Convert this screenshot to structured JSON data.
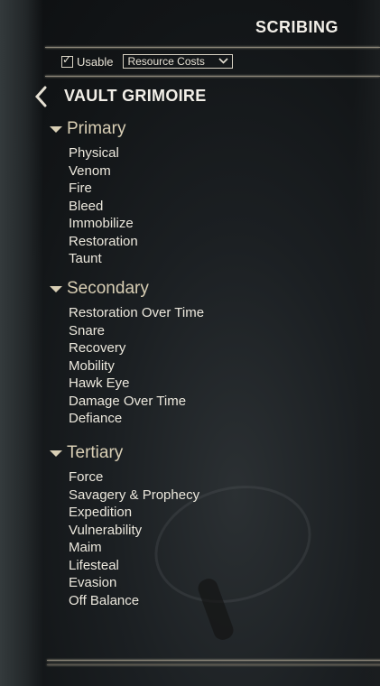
{
  "window": {
    "title": "SCRIBING"
  },
  "filter": {
    "usable_label": "Usable",
    "usable_checked": true,
    "sort_select": "Resource Costs"
  },
  "header": {
    "title": "VAULT GRIMOIRE"
  },
  "sections": [
    {
      "title": "Primary",
      "items": [
        "Physical",
        "Venom",
        "Fire",
        "Bleed",
        "Immobilize",
        "Restoration",
        "Taunt"
      ]
    },
    {
      "title": "Secondary",
      "items": [
        "Restoration Over Time",
        "Snare",
        "Recovery",
        "Mobility",
        "Hawk Eye",
        "Damage Over Time",
        "Defiance"
      ]
    },
    {
      "title": "Tertiary",
      "items": [
        "Force",
        "Savagery & Prophecy",
        "Expedition",
        "Vulnerability",
        "Maim",
        "Lifesteal",
        "Evasion",
        "Off Balance"
      ]
    }
  ],
  "icons": {
    "back": "chevron-left-icon",
    "section_toggle": "triangle-down-icon",
    "dropdown": "chevron-down-icon",
    "checkbox": "check-icon"
  },
  "colors": {
    "text": "#ece8dd",
    "section_title": "#d9cfb5",
    "divider": "#8d8779"
  }
}
